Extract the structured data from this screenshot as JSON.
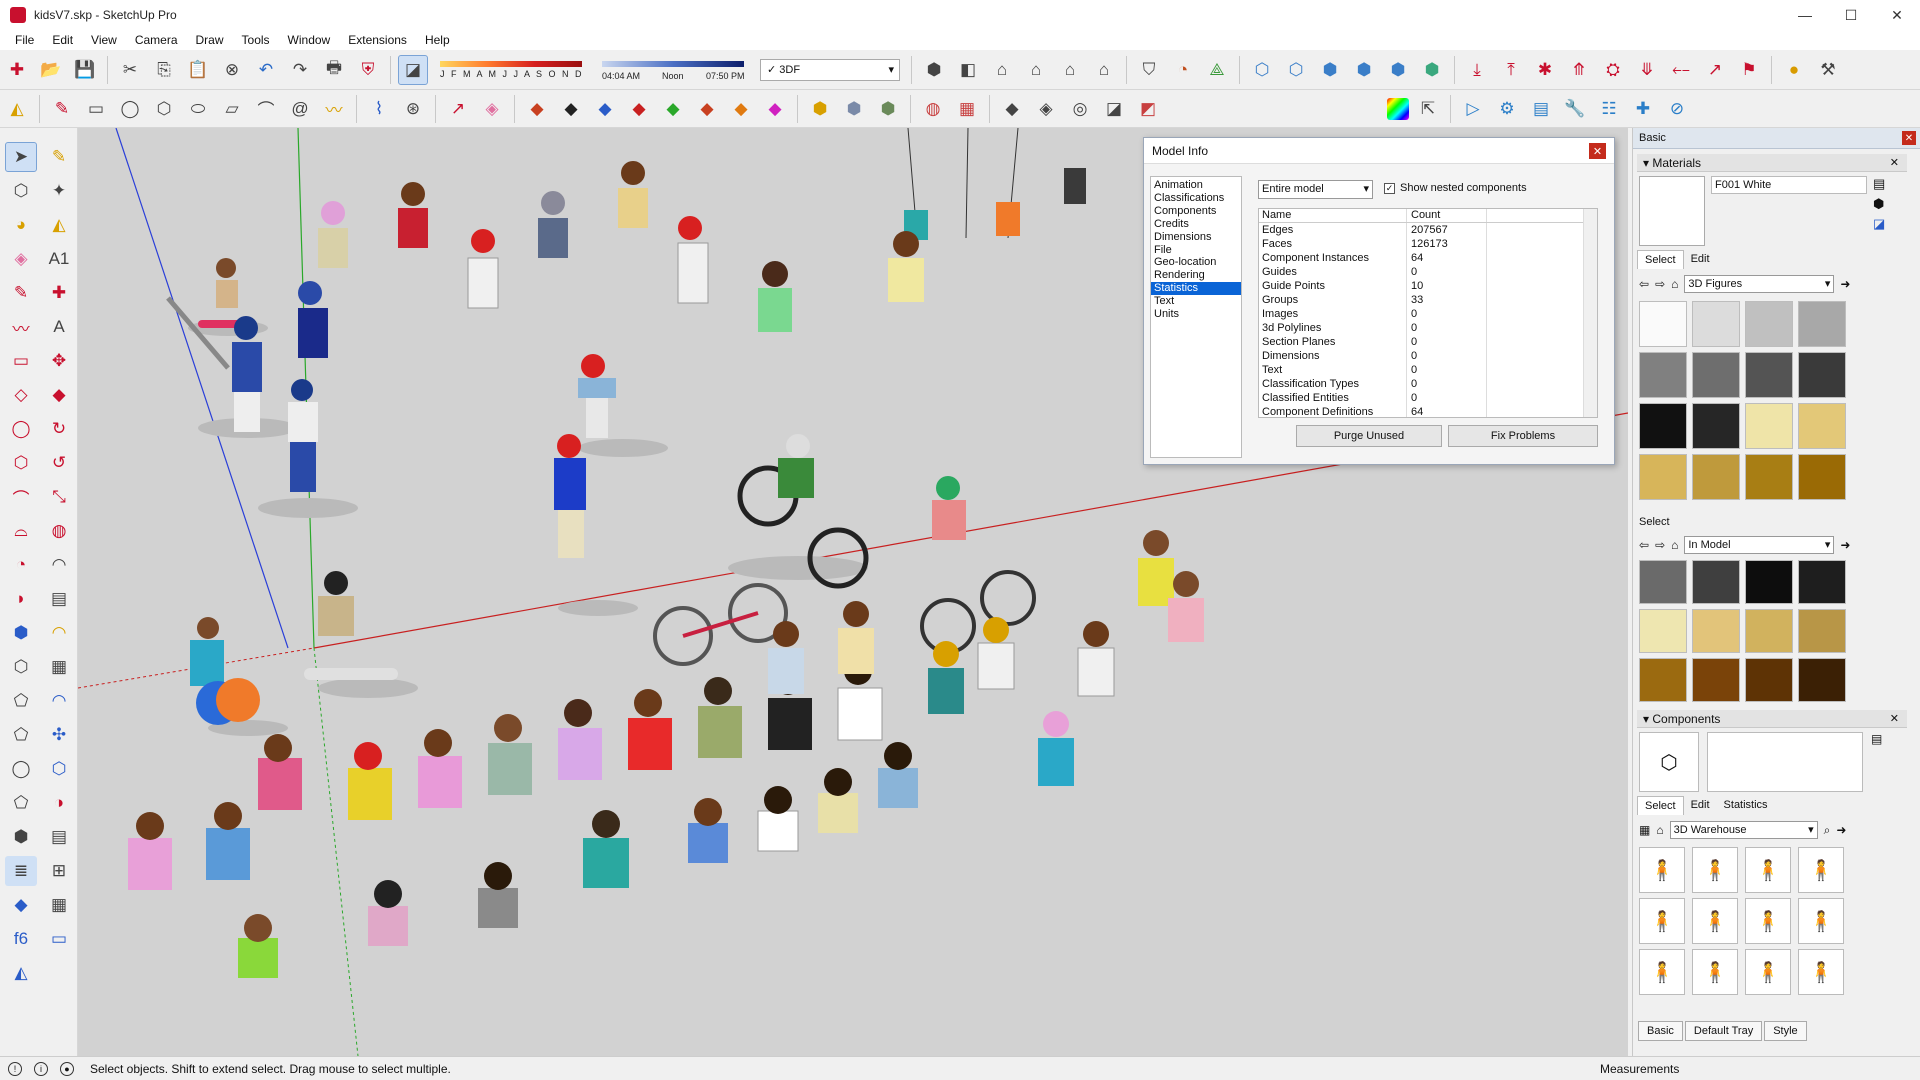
{
  "window": {
    "title": "kidsV7.skp - SketchUp Pro",
    "controls": [
      "—",
      "☐",
      "✕"
    ]
  },
  "menu": [
    "File",
    "Edit",
    "View",
    "Camera",
    "Draw",
    "Tools",
    "Window",
    "Extensions",
    "Help"
  ],
  "shadow_widget": {
    "months": "J F M A M J J A S O N D",
    "time_left": "04:04 AM",
    "time_mid": "Noon",
    "time_right": "07:50 PM"
  },
  "style_select": {
    "value": "3DF"
  },
  "model_info": {
    "title": "Model Info",
    "categories": [
      "Animation",
      "Classifications",
      "Components",
      "Credits",
      "Dimensions",
      "File",
      "Geo-location",
      "Rendering",
      "Statistics",
      "Text",
      "Units"
    ],
    "selected_category": "Statistics",
    "scope": "Entire model",
    "show_nested_label": "Show nested components",
    "table_headers": [
      "Name",
      "Count"
    ],
    "rows": [
      [
        "Edges",
        "207567"
      ],
      [
        "Faces",
        "126173"
      ],
      [
        "Component Instances",
        "64"
      ],
      [
        "Guides",
        "0"
      ],
      [
        "Guide Points",
        "10"
      ],
      [
        "Groups",
        "33"
      ],
      [
        "Images",
        "0"
      ],
      [
        "3d Polylines",
        "0"
      ],
      [
        "Section Planes",
        "0"
      ],
      [
        "Dimensions",
        "0"
      ],
      [
        "Text",
        "0"
      ],
      [
        "Classification Types",
        "0"
      ],
      [
        "Classified Entities",
        "0"
      ],
      [
        "Component Definitions",
        "64"
      ]
    ],
    "purge_label": "Purge Unused",
    "fix_label": "Fix Problems"
  },
  "tray": {
    "title": "Basic",
    "materials": {
      "header": "Materials",
      "material_name": "F001 White",
      "tab_select": "Select",
      "tab_edit": "Edit",
      "library": "3D Figures",
      "swatches": [
        "#fafafa",
        "#dcdcdc",
        "#c0c0c0",
        "#a8a8a8",
        "#808080",
        "#6e6e6e",
        "#545454",
        "#3a3a3a",
        "#111111",
        "#262626",
        "#efe4a8",
        "#e3c878",
        "#d7b55a",
        "#bf9a3c",
        "#a87e14",
        "#9a6a05"
      ],
      "select_label": "Select",
      "in_model": "In Model",
      "model_swatches": [
        "#6a6a6a",
        "#3f3f3f",
        "#0d0d0d",
        "#1e1e1e",
        "#eee6b0",
        "#e2c47a",
        "#d1b25e",
        "#b89647",
        "#9b6a10",
        "#7a4309",
        "#5e3305",
        "#3b2005"
      ]
    },
    "components": {
      "header": "Components",
      "tab_select": "Select",
      "tab_edit": "Edit",
      "tab_statistics": "Statistics",
      "search": "3D Warehouse"
    },
    "bottom_tabs": [
      "Basic",
      "Default Tray",
      "Style"
    ]
  },
  "status": {
    "message": "Select objects. Shift to extend select. Drag mouse to select multiple.",
    "measurements": "Measurements"
  }
}
